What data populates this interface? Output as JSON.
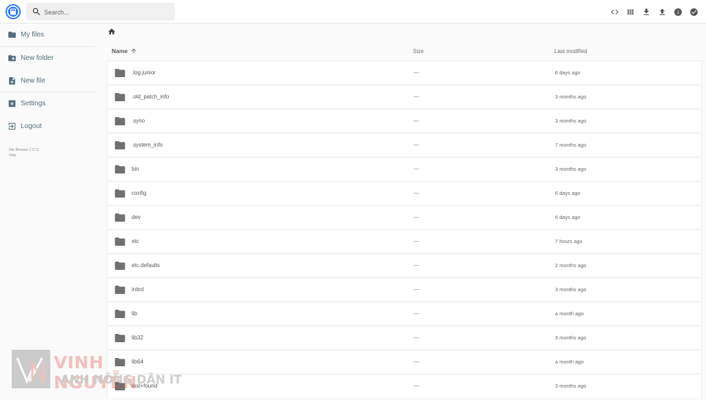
{
  "search": {
    "placeholder": "Search..."
  },
  "header": {
    "actions": [
      {
        "icon": "code-icon"
      },
      {
        "icon": "grid-view-icon"
      },
      {
        "icon": "download-icon"
      },
      {
        "icon": "upload-icon"
      },
      {
        "icon": "info-icon"
      },
      {
        "icon": "check-circle-icon"
      }
    ]
  },
  "sidebar": {
    "items": [
      {
        "label": "My files",
        "icon": "folder-icon"
      },
      {
        "label": "New folder",
        "icon": "new-folder-icon"
      },
      {
        "label": "New file",
        "icon": "new-file-icon"
      },
      {
        "label": "Settings",
        "icon": "settings-icon"
      },
      {
        "label": "Logout",
        "icon": "logout-icon"
      }
    ],
    "credits": {
      "version": "File Browser 2.17.2",
      "help": "Help"
    }
  },
  "listing": {
    "columns": {
      "name": "Name",
      "size": "Size",
      "modified": "Last modified"
    },
    "sort": "name-ascending",
    "rows": [
      {
        "name": ".log.junior",
        "size": "—",
        "modified": "6 days ago"
      },
      {
        "name": ".old_patch_info",
        "size": "—",
        "modified": "3 months ago"
      },
      {
        "name": ".syno",
        "size": "—",
        "modified": "3 months ago"
      },
      {
        "name": ".system_info",
        "size": "—",
        "modified": "7 months ago"
      },
      {
        "name": "bin",
        "size": "—",
        "modified": "3 months ago"
      },
      {
        "name": "config",
        "size": "—",
        "modified": "6 days ago"
      },
      {
        "name": "dev",
        "size": "—",
        "modified": "6 days ago"
      },
      {
        "name": "etc",
        "size": "—",
        "modified": "7 hours ago"
      },
      {
        "name": "etc.defaults",
        "size": "—",
        "modified": "2 months ago"
      },
      {
        "name": "initrd",
        "size": "—",
        "modified": "3 months ago"
      },
      {
        "name": "lib",
        "size": "—",
        "modified": "a month ago"
      },
      {
        "name": "lib32",
        "size": "—",
        "modified": "3 months ago"
      },
      {
        "name": "lib64",
        "size": "—",
        "modified": "a month ago"
      },
      {
        "name": "lost+found",
        "size": "—",
        "modified": "3 months ago"
      }
    ]
  },
  "watermark": {
    "line1": "VINH NGUYỄN",
    "line2": "ANH NÔNG DÂN IT"
  },
  "colors": {
    "accent": "#2979ff",
    "icon": "#546e7a",
    "folder": "#707070"
  }
}
